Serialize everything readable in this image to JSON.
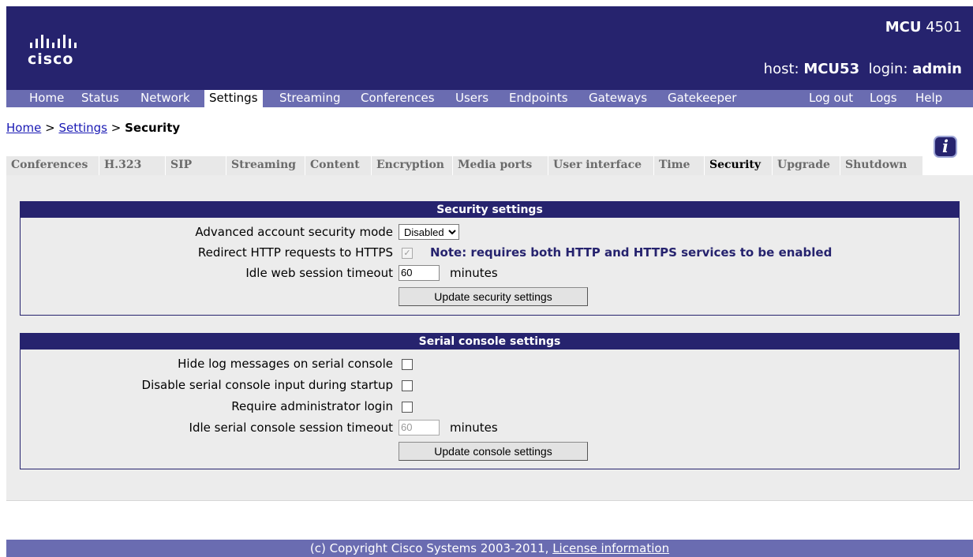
{
  "header": {
    "brand": "cisco",
    "model_bold": "MCU",
    "model_num": "4501",
    "host_label": "host:",
    "host_value": "MCU53",
    "login_label": "login:",
    "login_value": "admin"
  },
  "nav": {
    "items": [
      "Home",
      "Status",
      "Network",
      "Settings",
      "Streaming",
      "Conferences",
      "Users",
      "Endpoints",
      "Gateways",
      "Gatekeeper"
    ],
    "active": "Settings",
    "right_items": [
      "Log out",
      "Logs",
      "Help"
    ]
  },
  "breadcrumb": {
    "home": "Home",
    "sep1": ">",
    "settings": "Settings",
    "sep2": ">",
    "current": "Security"
  },
  "tabs": {
    "items": [
      "Conferences",
      "H.323",
      "SIP",
      "Streaming",
      "Content",
      "Encryption",
      "Media ports",
      "User interface",
      "Time",
      "Security",
      "Upgrade",
      "Shutdown"
    ],
    "active": "Security"
  },
  "security": {
    "title": "Security settings",
    "advanced_label": "Advanced account security mode",
    "advanced_value": "Disabled",
    "redirect_label": "Redirect HTTP requests to HTTPS",
    "redirect_checked": true,
    "redirect_note": "Note: requires both HTTP and HTTPS services to be enabled",
    "idle_label": "Idle web session timeout",
    "idle_value": "60",
    "idle_unit": "minutes",
    "update_button": "Update security settings"
  },
  "console": {
    "title": "Serial console settings",
    "hide_label": "Hide log messages on serial console",
    "disable_label": "Disable serial console input during startup",
    "require_label": "Require administrator login",
    "idle_label": "Idle serial console session timeout",
    "idle_value": "60",
    "idle_unit": "minutes",
    "update_button": "Update console settings"
  },
  "footer": {
    "copyright": "(c) Copyright Cisco Systems 2003-2011,",
    "license_link": "License information"
  },
  "colors": {
    "header_bg": "#26236e",
    "nav_bg": "#6a6cb1",
    "panel_bg": "#ececec",
    "link": "#1a1ab4"
  }
}
